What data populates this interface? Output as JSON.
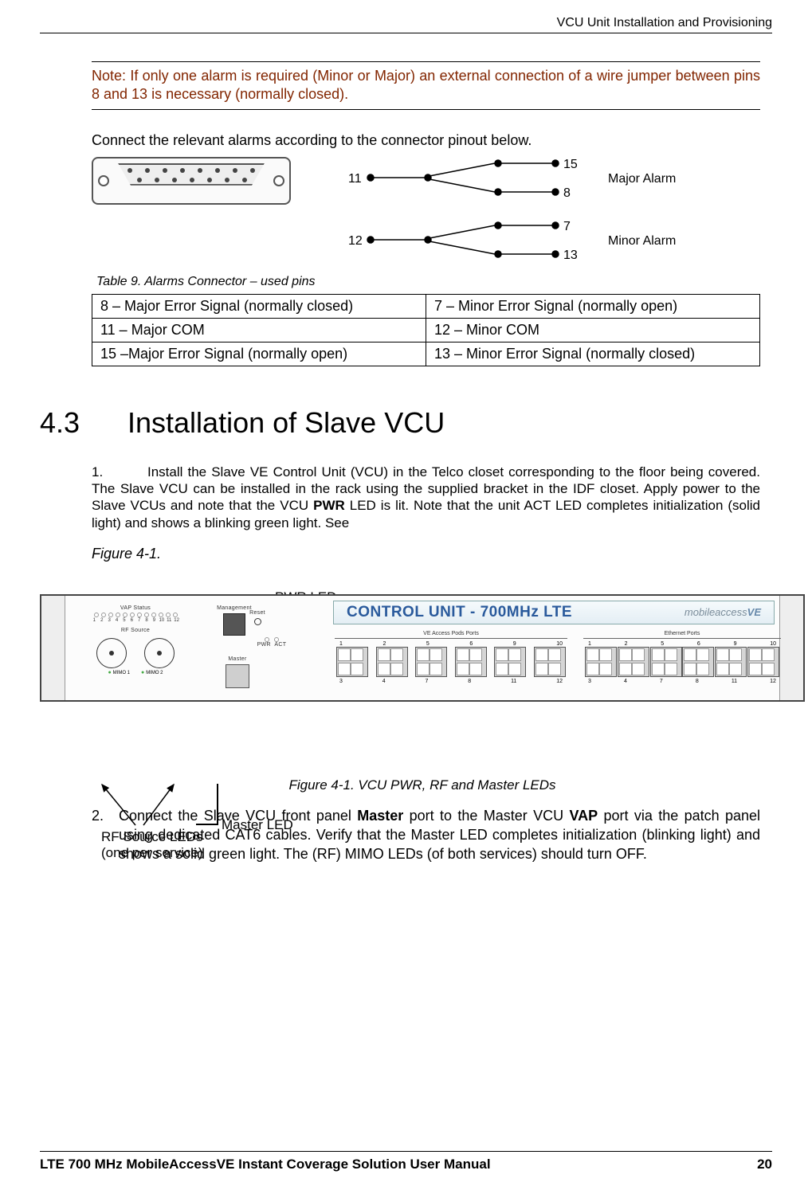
{
  "running_header": "VCU Unit Installation and Provisioning",
  "note_text": "Note: If only one alarm is required (Minor or Major) an external connection of a wire jumper between pins 8 and 13 is necessary (normally closed).",
  "connect_para": "Connect the relevant alarms according to the connector pinout below.",
  "wiring": {
    "in_top": "11",
    "out_top_a": "15",
    "out_top_b": "8",
    "label_top": "Major Alarm",
    "in_bot": "12",
    "out_bot_a": "7",
    "out_bot_b": "13",
    "label_bot": "Minor Alarm"
  },
  "table_caption": "Table 9. Alarms Connector – used pins",
  "pin_table": [
    [
      "8 – Major Error Signal (normally closed)",
      "7 – Minor Error Signal (normally open)"
    ],
    [
      "11 – Major COM",
      "12 – Minor COM"
    ],
    [
      "15 –Major Error Signal (normally open)",
      "13 – Minor Error Signal (normally closed)"
    ]
  ],
  "section_num": "4.3",
  "section_title": "Installation of Slave VCU",
  "step1_num": "1.",
  "step1_a": "Install the Slave VE Control Unit (VCU) in the Telco closet corresponding to the floor being covered. The Slave VCU can be installed in the rack using the supplied bracket in the IDF closet. Apply power to the Slave VCUs and note that the VCU ",
  "step1_bold1": "PWR",
  "step1_b": " LED is lit. Note that the unit ACT LED completes initialization (solid light) and shows a blinking green light. See",
  "fig_ref": "Figure 4-1.",
  "unit": {
    "pwr_label": "PWR LED",
    "title": "CONTROL UNIT - 700MHz LTE",
    "brand_a": "mobileaccess",
    "brand_b": "VE",
    "vap_status": "VAP Status",
    "vap_nums": [
      "1",
      "2",
      "3",
      "4",
      "5",
      "6",
      "7",
      "8",
      "9",
      "10",
      "11",
      "12"
    ],
    "rf_source": "RF Source",
    "mimo1": "MIMO 1",
    "mimo2": "MIMO 2",
    "mgmt": "Management",
    "reset": "Reset",
    "pwr": "PWR",
    "act": "ACT",
    "master": "Master",
    "bank_left_label": "VE Access Pods Ports",
    "bank_right_label": "Ethernet Ports",
    "ports_top_left": [
      "1",
      "2",
      "5",
      "6",
      "9",
      "10"
    ],
    "ports_bot_left": [
      "3",
      "4",
      "7",
      "8",
      "11",
      "12"
    ],
    "ports_top_right": [
      "1",
      "2",
      "5",
      "6",
      "9",
      "10"
    ],
    "ports_bot_right": [
      "3",
      "4",
      "7",
      "8",
      "11",
      "12"
    ],
    "master_led_label": "Master LED",
    "rf_led_label_a": "RF Source LEDs",
    "rf_led_label_b": "(one per service)"
  },
  "fig_caption": "Figure 4-1. VCU PWR, RF and Master LEDs",
  "step2_num": "2.",
  "step2_a": "Connect the Slave VCU front panel ",
  "step2_bold1": "Master",
  "step2_b": " port to the Master VCU ",
  "step2_bold2": "VAP",
  "step2_c": " port via the patch panel using dedicated CAT6 cables. Verify that the Master LED completes initialization (blinking light) and shows a solid green light. The (RF) MIMO LEDs (of both services) should turn OFF.",
  "footer_left": "LTE 700 MHz MobileAccessVE Instant Coverage Solution User Manual",
  "footer_right": "20"
}
